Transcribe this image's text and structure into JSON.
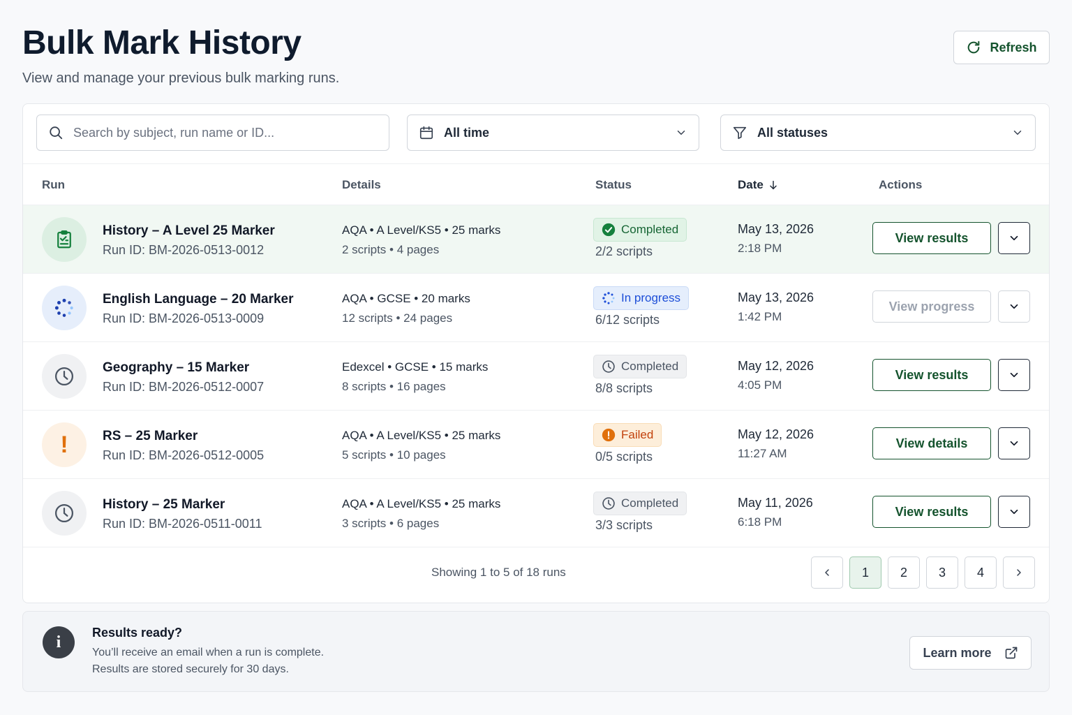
{
  "header": {
    "title": "Bulk Mark History",
    "subtitle": "View and manage your previous bulk marking runs.",
    "refresh_label": "Refresh"
  },
  "filters": {
    "search_placeholder": "Search by subject, run name or ID...",
    "time_value": "All time",
    "status_value": "All statuses"
  },
  "table": {
    "columns": {
      "run": "Run",
      "details": "Details",
      "status": "Status",
      "date": "Date",
      "actions": "Actions"
    },
    "rows": [
      {
        "name": "History – A Level 25 Marker",
        "run_id": "Run ID: BM-2026-0513-0012",
        "details_line1": "AQA • A Level/KS5 • 25 marks",
        "details_line2": "2 scripts • 4 pages",
        "status": "Completed",
        "scripts": "2/2 scripts",
        "date": "May 13, 2026",
        "time": "2:18 PM",
        "action": "View results",
        "icon": "clipboard-icon",
        "status_color": "#166534"
      },
      {
        "name": "English Language – 20 Marker",
        "run_id": "Run ID: BM-2026-0513-0009",
        "details_line1": "AQA • GCSE • 20 marks",
        "details_line2": "12 scripts • 24 pages",
        "status": "In progress",
        "scripts": "6/12 scripts",
        "date": "May 13, 2026",
        "time": "1:42 PM",
        "action": "View progress",
        "icon": "spinner-icon",
        "status_color": "#1d4ed8"
      },
      {
        "name": "Geography – 15 Marker",
        "run_id": "Run ID: BM-2026-0512-0007",
        "details_line1": "Edexcel • GCSE • 15 marks",
        "details_line2": "8 scripts • 16 pages",
        "status": "Completed",
        "scripts": "8/8 scripts",
        "date": "May 12, 2026",
        "time": "4:05 PM",
        "action": "View results",
        "icon": "clock-icon",
        "status_color": "#4b5563"
      },
      {
        "name": "RS – 25 Marker",
        "run_id": "Run ID: BM-2026-0512-0005",
        "details_line1": "AQA • A Level/KS5 • 25 marks",
        "details_line2": "5 scripts • 10 pages",
        "status": "Failed",
        "scripts": "0/5 scripts",
        "date": "May 12, 2026",
        "time": "11:27 AM",
        "action": "View details",
        "icon": "exclamation-icon",
        "icon_text": "!",
        "status_color": "#c2410c"
      },
      {
        "name": "History – 25 Marker",
        "run_id": "Run ID: BM-2026-0511-0011",
        "details_line1": "AQA • A Level/KS5 • 25 marks",
        "details_line2": "3 scripts • 6 pages",
        "status": "Completed",
        "scripts": "3/3 scripts",
        "date": "May 11, 2026",
        "time": "6:18 PM",
        "action": "View results",
        "icon": "clock-icon",
        "status_color": "#4b5563"
      }
    ]
  },
  "pagination": {
    "showing": "Showing 1 to 5 of 18 runs",
    "pages": [
      "1",
      "2",
      "3",
      "4"
    ],
    "current": "1"
  },
  "info": {
    "icon_text": "i",
    "title": "Results ready?",
    "line1": "You’ll receive an email when a run is complete.",
    "line2": "Results are stored securely for 30 days.",
    "button": "Learn more"
  },
  "colors": {
    "accent": "#14532d",
    "highlight_row": "#f1f8f3"
  }
}
